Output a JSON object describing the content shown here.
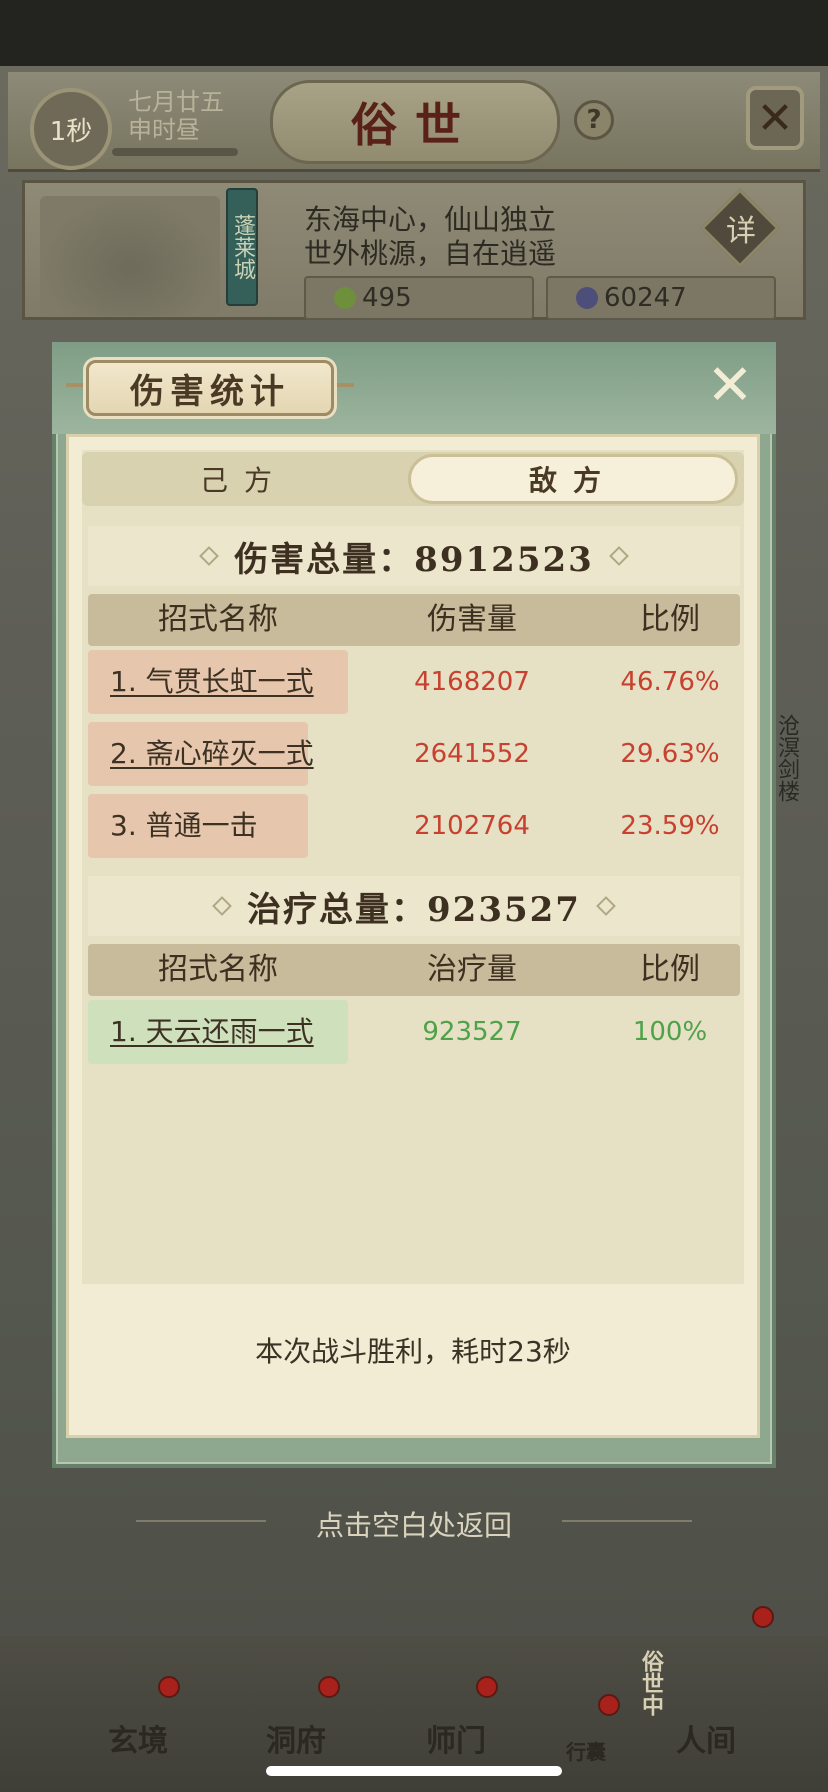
{
  "header": {
    "timer": "1秒",
    "date_line1": "七月廿五",
    "date_line2": "申时昼",
    "title": "俗世",
    "help": "?"
  },
  "location": {
    "city": "蓬莱城",
    "desc_line1": "东海中心，仙山独立",
    "desc_line2": "世外桃源，自在逍遥",
    "detail": "详",
    "resource1": "495",
    "resource2": "60247",
    "side_label": "沧溟剑楼"
  },
  "modal": {
    "title": "伤害统计",
    "tabs": {
      "own": "己方",
      "enemy": "敌方"
    },
    "damage": {
      "header": "伤害总量：8912523",
      "columns": [
        "招式名称",
        "伤害量",
        "比例"
      ],
      "rows": [
        {
          "name": "1. 气贯长虹一式",
          "value": "4168207",
          "ratio": "46.76%",
          "share": 0.4676
        },
        {
          "name": "2. 斋心碎灭一式",
          "value": "2641552",
          "ratio": "29.63%",
          "share": 0.2963
        },
        {
          "name": "3. 普通一击",
          "value": "2102764",
          "ratio": "23.59%",
          "share": 0.2359
        }
      ]
    },
    "healing": {
      "header": "治疗总量：923527",
      "columns": [
        "招式名称",
        "治疗量",
        "比例"
      ],
      "rows": [
        {
          "name": "1. 天云还雨一式",
          "value": "923527",
          "ratio": "100%",
          "share": 1.0
        }
      ]
    },
    "footer": "本次战斗胜利，耗时23秒",
    "return_hint": "点击空白处返回"
  },
  "nav": {
    "items": [
      "玄境",
      "洞府",
      "师门",
      "行囊",
      "人间"
    ],
    "side": "俗世中"
  },
  "colors": {
    "damage_value": "#c8402f",
    "heal_value": "#4fa24a",
    "damage_bar": "#e6c7ad",
    "heal_bar": "#cfe0bd"
  }
}
